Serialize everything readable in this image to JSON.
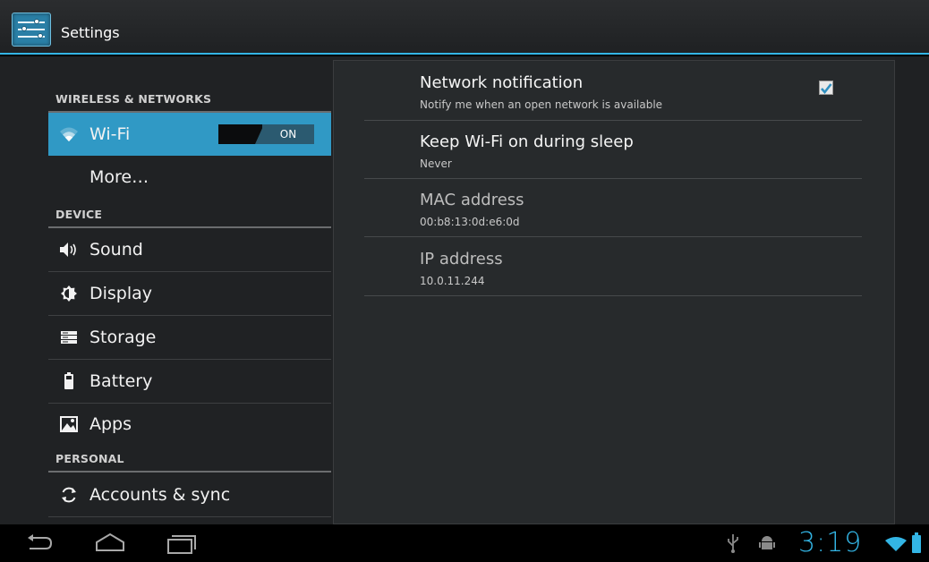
{
  "app": {
    "title": "Settings"
  },
  "sidebar": {
    "headers": {
      "wireless": "WIRELESS & NETWORKS",
      "device": "DEVICE",
      "personal": "PERSONAL"
    },
    "items": {
      "wifi": {
        "label": "Wi-Fi",
        "toggle": "ON"
      },
      "more": {
        "label": "More…"
      },
      "sound": {
        "label": "Sound"
      },
      "display": {
        "label": "Display"
      },
      "storage": {
        "label": "Storage"
      },
      "battery": {
        "label": "Battery"
      },
      "apps": {
        "label": "Apps"
      },
      "accounts": {
        "label": "Accounts & sync"
      }
    }
  },
  "wifi_settings": {
    "network_notification": {
      "title": "Network notification",
      "summary": "Notify me when an open network is available",
      "checked": true
    },
    "keep_wifi": {
      "title": "Keep Wi-Fi on during sleep",
      "summary": "Never"
    },
    "mac": {
      "title": "MAC address",
      "summary": "00:b8:13:0d:e6:0d"
    },
    "ip": {
      "title": "IP address",
      "summary": "10.0.11.244"
    }
  },
  "status_bar": {
    "time": "3:19"
  },
  "colors": {
    "accent": "#33b5e5",
    "selected": "#3099c5"
  }
}
